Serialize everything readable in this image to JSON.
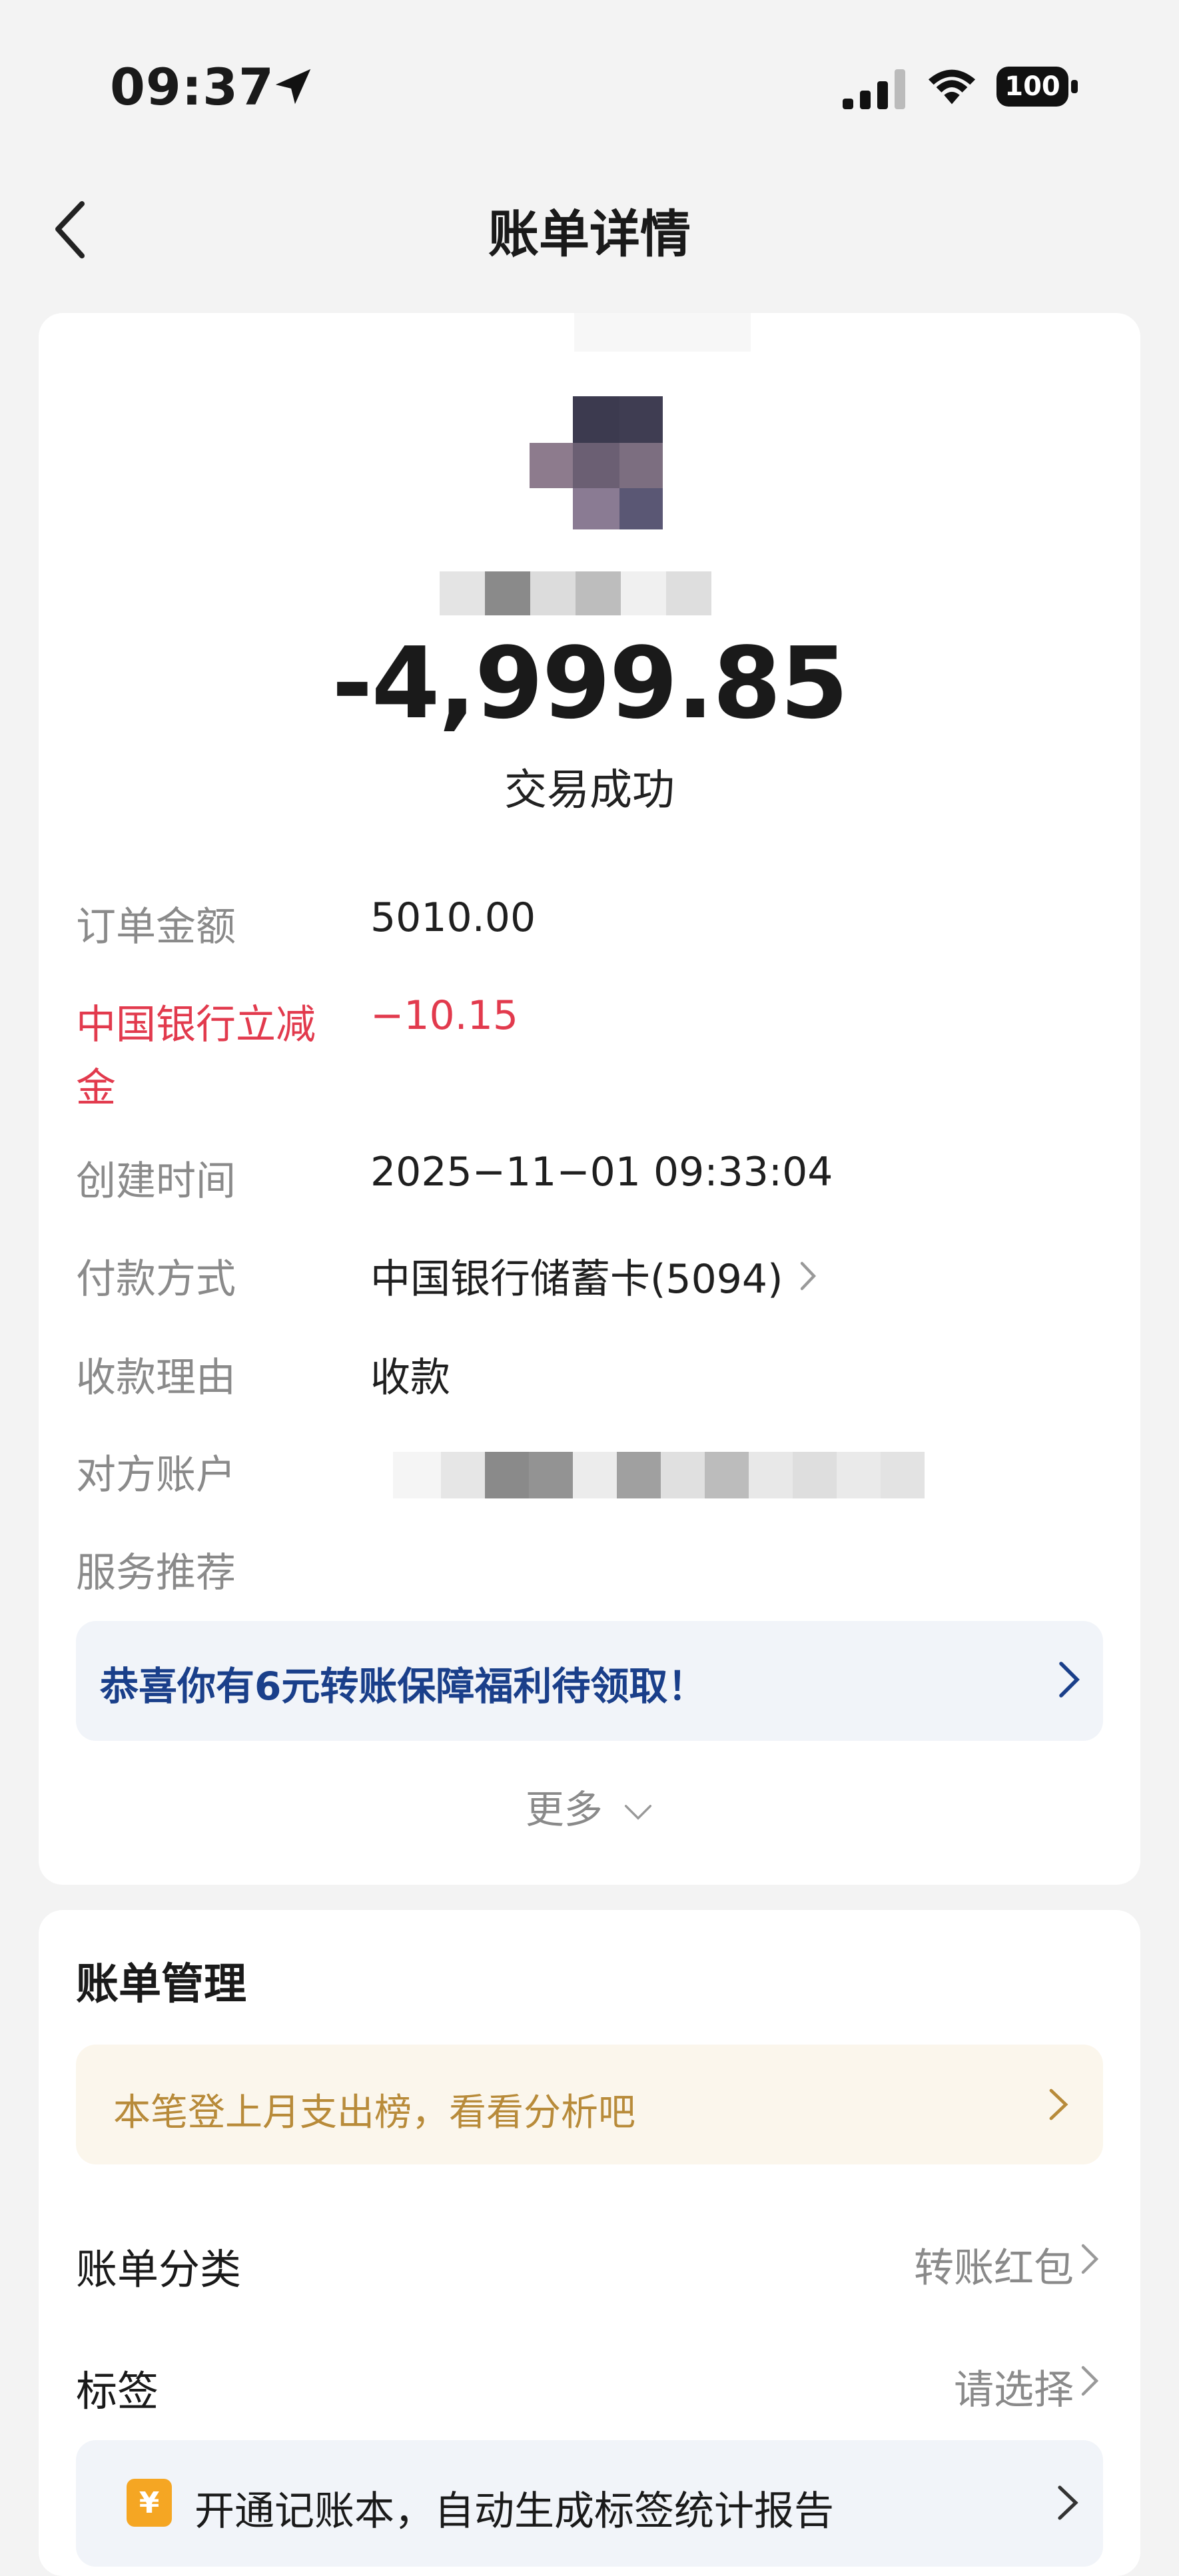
{
  "status_bar": {
    "time": "09:37",
    "battery": "100"
  },
  "nav": {
    "title": "账单详情"
  },
  "transaction": {
    "amount": "-4,999.85",
    "status": "交易成功"
  },
  "details": [
    {
      "label": "订单金额",
      "value": "5010.00",
      "highlight": false
    },
    {
      "label_line1": "中国银行立减",
      "label_line2": "金",
      "value": "−10.15",
      "highlight": true
    },
    {
      "label": "创建时间",
      "value": "2025−11−01 09:33:04"
    },
    {
      "label": "付款方式",
      "value": "中国银行储蓄卡(5094)"
    },
    {
      "label": "收款理由",
      "value": "收款"
    },
    {
      "label": "对方账户",
      "value": ""
    },
    {
      "label": "服务推荐"
    }
  ],
  "promo": {
    "text": "恭喜你有6元转账保障福利待领取！"
  },
  "more": {
    "label": "更多"
  },
  "management": {
    "title": "账单管理",
    "analysis": "本笔登上月支出榜，看看分析吧",
    "category": {
      "label": "账单分类",
      "value": "转账红包"
    },
    "tag": {
      "label": "标签",
      "value": "请选择"
    },
    "ledger": {
      "icon_text": "¥",
      "text": "开通记账本，自动生成标签统计报告"
    }
  },
  "colors": {
    "accent_red": "#e23a4d",
    "promo_blue": "#1a3f8a",
    "analysis_gold": "#b88b3a",
    "ledger_orange": "#f5a623"
  }
}
